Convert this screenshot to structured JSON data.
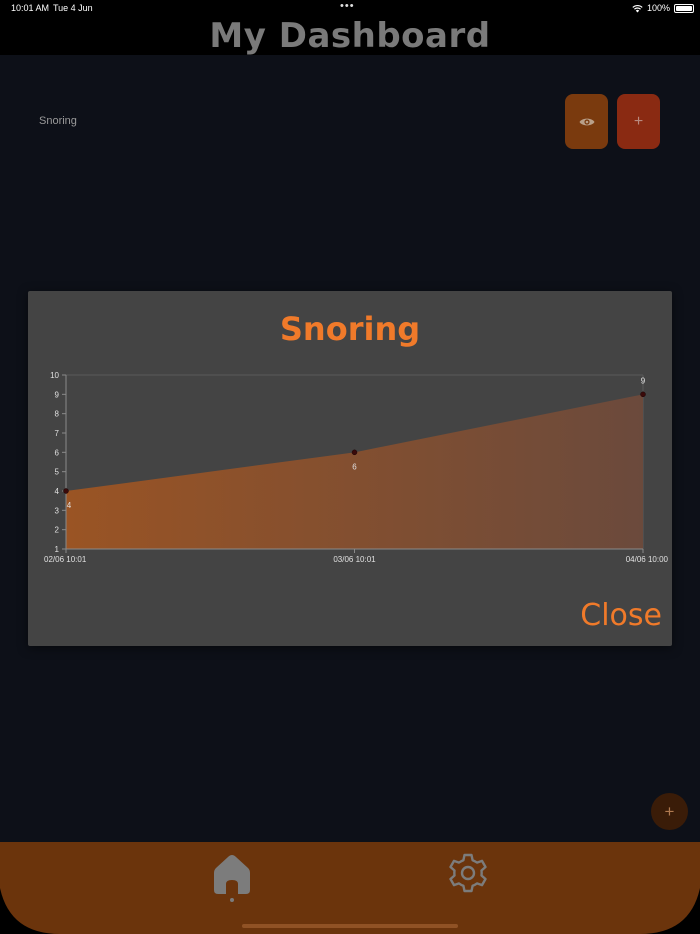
{
  "status_bar": {
    "time": "10:01 AM",
    "date": "Tue 4 Jun",
    "dots": "•••",
    "battery": "100%"
  },
  "header": {
    "title": "My Dashboard"
  },
  "widget": {
    "label": "Snoring",
    "view_icon": "eye-icon",
    "add_label": "+"
  },
  "fab": {
    "label": "+"
  },
  "modal": {
    "title": "Snoring",
    "close_label": "Close"
  },
  "chart_data": {
    "type": "area",
    "title": "Snoring",
    "x": [
      "02/06 10:01",
      "03/06 10:01",
      "04/06 10:00"
    ],
    "y": [
      4,
      6,
      9
    ],
    "data_labels": [
      "4",
      "6",
      "9"
    ],
    "ylim": [
      1,
      10
    ],
    "yticks": [
      "1",
      "2",
      "3",
      "4",
      "5",
      "6",
      "7",
      "8",
      "9",
      "10"
    ],
    "xlabel": "",
    "ylabel": "",
    "grid": false,
    "colors": {
      "fill_start": "#9a5424",
      "fill_end": "#6b4a3c",
      "point": "#3a0a0a",
      "axis": "#8a8a8a",
      "tick_text": "#e0e0e0"
    }
  },
  "nav": {
    "home_icon": "home-icon",
    "settings_icon": "gear-icon",
    "background": "#6b340c"
  }
}
